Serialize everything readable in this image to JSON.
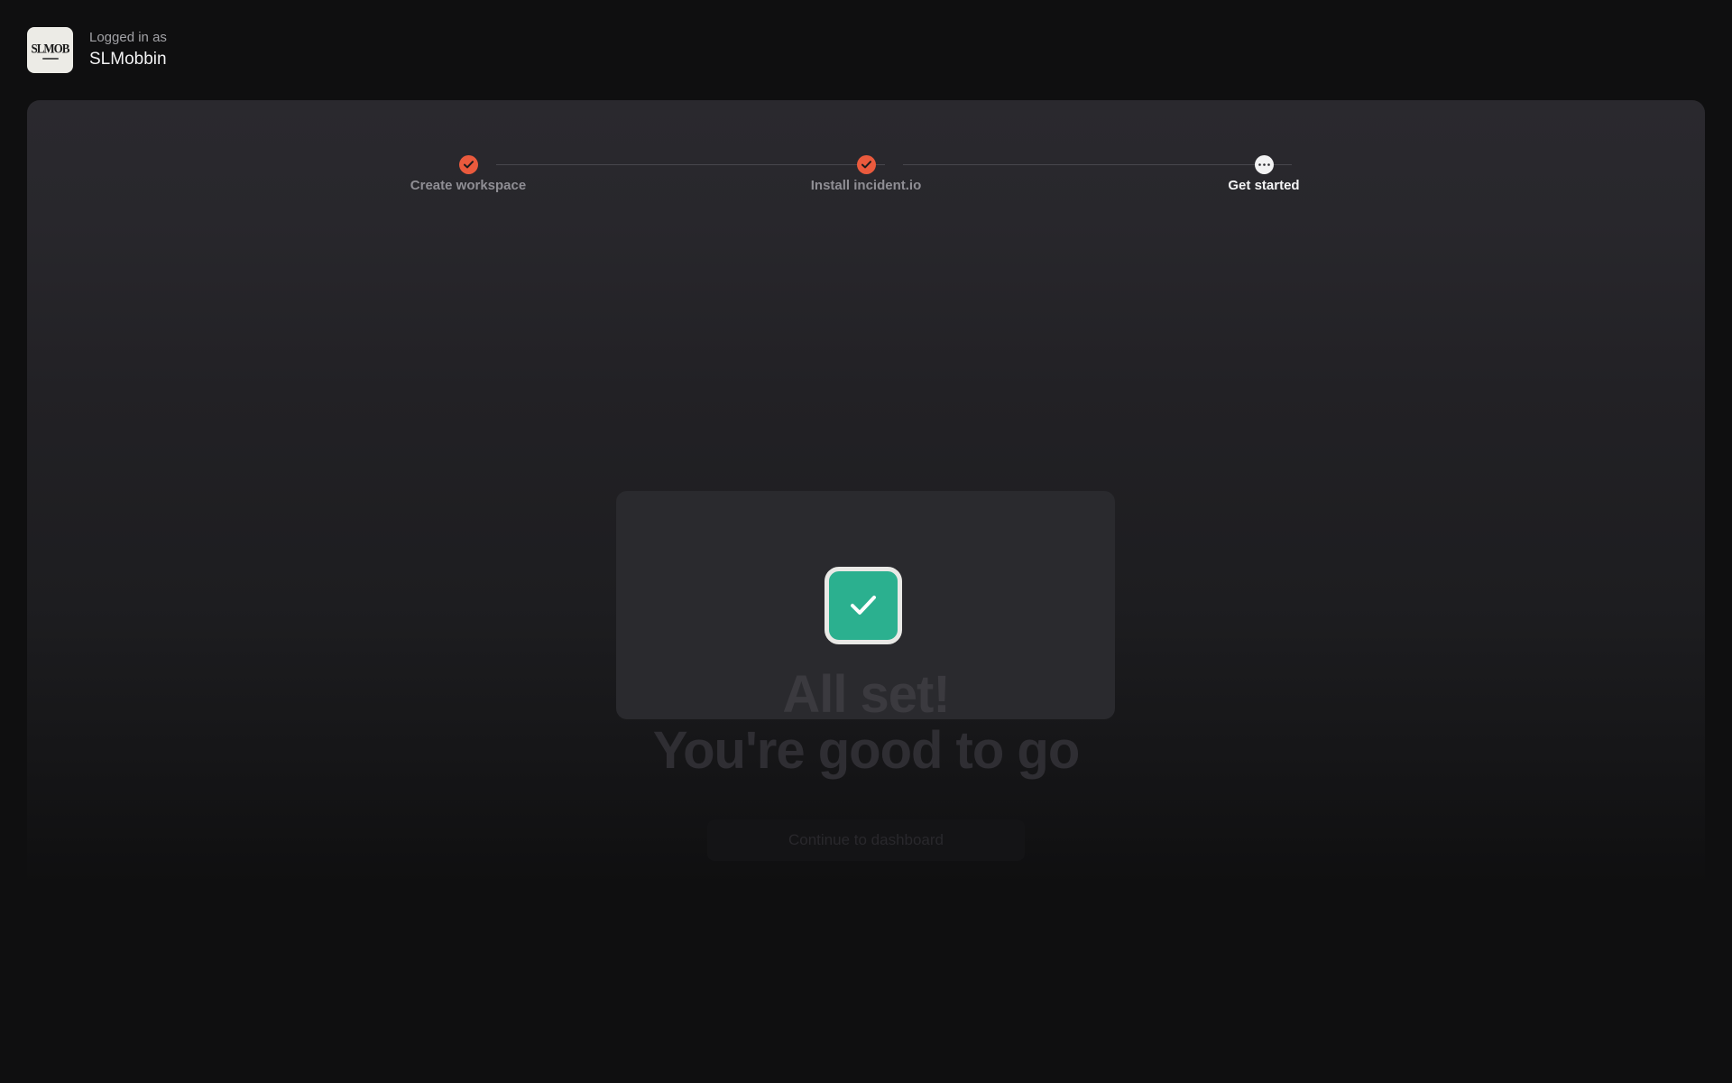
{
  "header": {
    "avatar_label": "SLMOB",
    "logged_in_label": "Logged in as",
    "user_name": "SLMobbin"
  },
  "stepper": {
    "steps": [
      {
        "label": "Create workspace",
        "status": "complete"
      },
      {
        "label": "Install incident.io",
        "status": "complete"
      },
      {
        "label": "Get started",
        "status": "current"
      }
    ]
  },
  "completion": {
    "icon": "check-icon",
    "title_line_1": "All set!",
    "title_line_2": "You're good to go",
    "continue_label": "Continue to dashboard"
  },
  "colors": {
    "accent": "#ea5a3d",
    "success": "#2bb08f",
    "background": "#0f0f10",
    "panel": "#2a292e"
  }
}
